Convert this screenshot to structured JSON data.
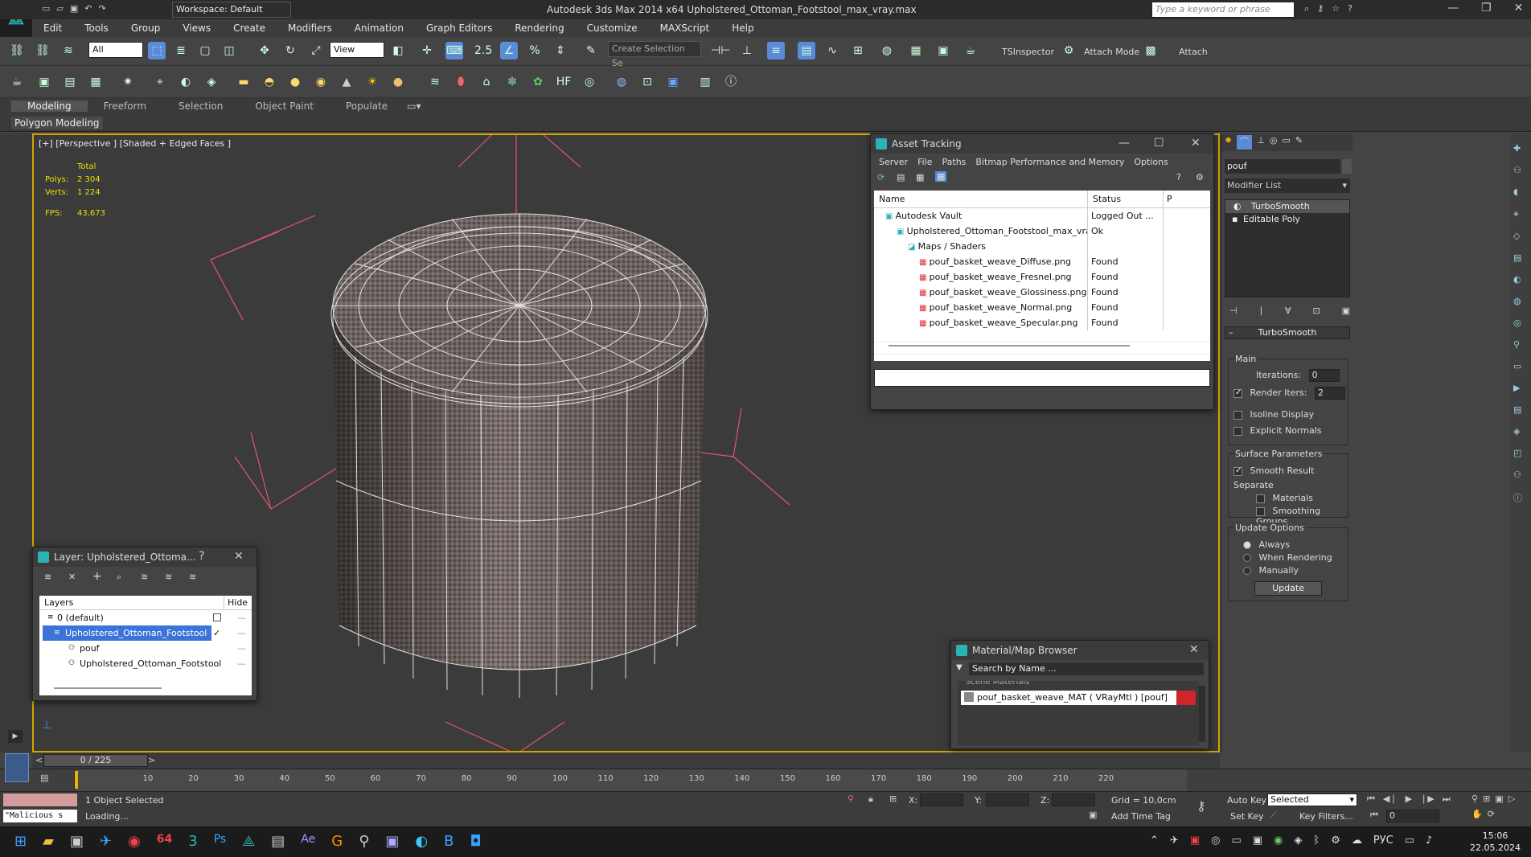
{
  "app": {
    "title": "Autodesk 3ds Max  2014 x64     Upholstered_Ottoman_Footstool_max_vray.max",
    "workspace": "Workspace: Default",
    "search_placeholder": "Type a keyword or phrase"
  },
  "menu": [
    "Edit",
    "Tools",
    "Group",
    "Views",
    "Create",
    "Modifiers",
    "Animation",
    "Graph Editors",
    "Rendering",
    "Customize",
    "MAXScript",
    "Help"
  ],
  "toolbar": {
    "filter": "All",
    "view": "View",
    "selection_set": "Create Selection Se",
    "tsinspector": "TSInspector",
    "attach_mode": "Attach Mode",
    "attach": "Attach"
  },
  "ribbon": {
    "tabs": [
      "Modeling",
      "Freeform",
      "Selection",
      "Object Paint",
      "Populate"
    ],
    "sub": "Polygon Modeling"
  },
  "viewport": {
    "label": "[+] [Perspective ] [Shaded + Edged Faces ]",
    "stats_total": "Total",
    "polys_label": "Polys:",
    "polys": "2 304",
    "verts_label": "Verts:",
    "verts": "1 224",
    "fps_label": "FPS:",
    "fps": "43,673"
  },
  "asset_tracking": {
    "title": "Asset Tracking",
    "menu": [
      "Server",
      "File",
      "Paths",
      "Bitmap Performance and Memory",
      "Options"
    ],
    "col_name": "Name",
    "col_status": "Status",
    "col_p": "P",
    "rows": [
      {
        "name": "Autodesk Vault",
        "status": "Logged Out ...",
        "indent": 1
      },
      {
        "name": "Upholstered_Ottoman_Footstool_max_vray.max",
        "status": "Ok",
        "indent": 2
      },
      {
        "name": "Maps / Shaders",
        "status": "",
        "indent": 3
      },
      {
        "name": "pouf_basket_weave_Diffuse.png",
        "status": "Found",
        "indent": 4
      },
      {
        "name": "pouf_basket_weave_Fresnel.png",
        "status": "Found",
        "indent": 4
      },
      {
        "name": "pouf_basket_weave_Glossiness.png",
        "status": "Found",
        "indent": 4
      },
      {
        "name": "pouf_basket_weave_Normal.png",
        "status": "Found",
        "indent": 4
      },
      {
        "name": "pouf_basket_weave_Specular.png",
        "status": "Found",
        "indent": 4
      }
    ]
  },
  "layer_window": {
    "title": "Layer: Upholstered_Ottoma...",
    "col_layers": "Layers",
    "col_hide": "Hide",
    "rows": [
      {
        "name": "0 (default)"
      },
      {
        "name": "Upholstered_Ottoman_Footstool"
      },
      {
        "name": "pouf"
      },
      {
        "name": "Upholstered_Ottoman_Footstool"
      }
    ]
  },
  "material_browser": {
    "title": "Material/Map Browser",
    "search": "Search by Name ...",
    "section": "Scene Materials",
    "item": "pouf_basket_weave_MAT  ( VRayMtl )  [pouf]"
  },
  "command_panel": {
    "object_name": "pouf",
    "modifier_list": "Modifier List",
    "stack": [
      "TurboSmooth",
      "Editable Poly"
    ],
    "rollout": "TurboSmooth",
    "main": "Main",
    "iterations_label": "Iterations:",
    "iterations": "0",
    "render_iters_label": "Render Iters:",
    "render_iters": "2",
    "isoline": "Isoline Display",
    "explicit_normals": "Explicit Normals",
    "surface_params": "Surface Parameters",
    "smooth_result": "Smooth Result",
    "separate": "Separate",
    "materials": "Materials",
    "smoothing_groups": "Smoothing Groups",
    "update_options": "Update Options",
    "always": "Always",
    "when_rendering": "When Rendering",
    "manually": "Manually",
    "update": "Update"
  },
  "timeline": {
    "frame": "0 / 225",
    "ticks": [
      "10",
      "20",
      "30",
      "40",
      "50",
      "60",
      "70",
      "80",
      "90",
      "100",
      "110",
      "120",
      "130",
      "140",
      "150",
      "160",
      "170",
      "180",
      "190",
      "200",
      "210",
      "220"
    ]
  },
  "status": {
    "script": "\"Malicious s",
    "selected": "1 Object Selected",
    "loading": "Loading...",
    "x": "X:",
    "y": "Y:",
    "z": "Z:",
    "grid": "Grid = 10,0cm",
    "add_time_tag": "Add Time Tag",
    "auto_key": "Auto Key",
    "set_key": "Set Key",
    "selected_dd": "Selected",
    "key_filters": "Key Filters...",
    "frame_field": "0"
  },
  "taskbar": {
    "lang": "РУС",
    "time": "15:06",
    "date": "22.05.2024"
  },
  "colors": {
    "accent": "#2bb3b3",
    "viewport_border": "#d3a400",
    "selection": "#3a74d9",
    "gizmo": "#e0556e"
  }
}
